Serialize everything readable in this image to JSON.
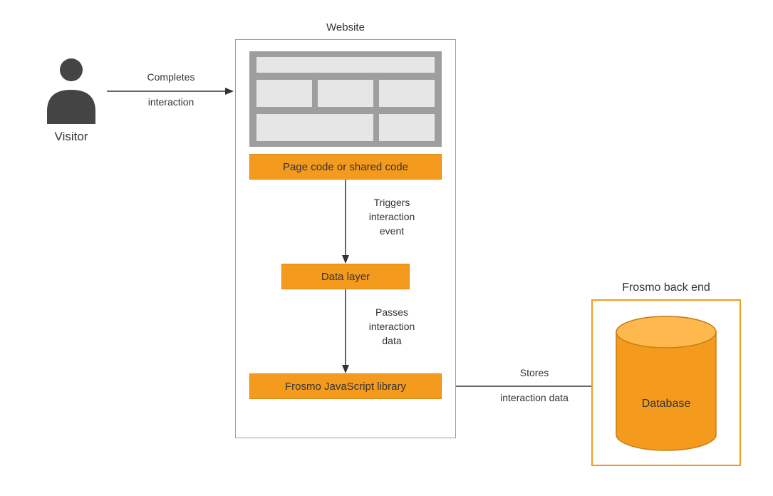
{
  "visitor_label": "Visitor",
  "website_title": "Website",
  "backend_title": "Frosmo back end",
  "box_page_code": "Page code or shared code",
  "box_data_layer": "Data layer",
  "box_js_library": "Frosmo JavaScript library",
  "database_label": "Database",
  "arrow1_line1": "Completes",
  "arrow1_line2": "interaction",
  "arrow2_line1": "Triggers",
  "arrow2_line2": "interaction",
  "arrow2_line3": "event",
  "arrow3_line1": "Passes",
  "arrow3_line2": "interaction",
  "arrow3_line3": "data",
  "arrow4_line1": "Stores",
  "arrow4_line2": "interaction data"
}
